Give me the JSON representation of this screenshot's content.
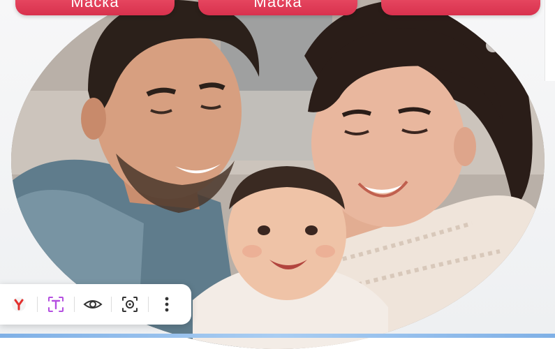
{
  "buttons": [
    {
      "label": "Маска"
    },
    {
      "label": "Маска"
    },
    {
      "label": ""
    }
  ],
  "toolbar": {
    "items": [
      "yandex-icon",
      "translate-icon",
      "eye-icon",
      "camera-search-icon",
      "more-vert-icon"
    ]
  },
  "colors": {
    "button_accent": "#e23e59",
    "toolbar_bg": "#ffffff",
    "strip": "#8dbbec",
    "translate_icon": "#b44fe0",
    "yandex_icon": "#e2312f"
  }
}
